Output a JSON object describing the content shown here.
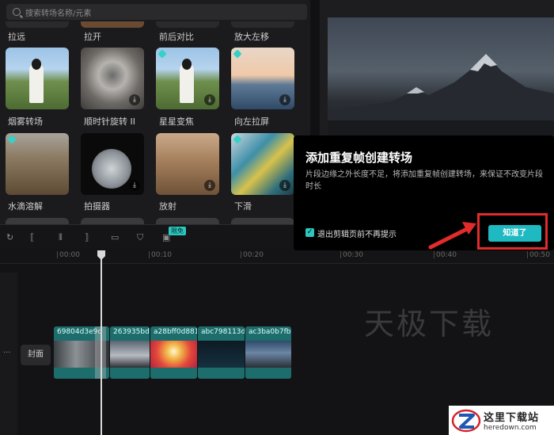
{
  "search": {
    "placeholder": "搜索转场名称/元素"
  },
  "transitions": {
    "row0": [
      "拉远",
      "拉开",
      "前后对比",
      "放大左移"
    ],
    "row1": [
      "烟雾转场",
      "顺时针旋转 II",
      "星星变焦",
      "向左拉屏"
    ],
    "row2": [
      "水滴溶解",
      "拍摄器",
      "放射",
      "下滑"
    ]
  },
  "toolbar": {
    "badge": "限免"
  },
  "ruler": {
    "ticks": [
      "00:00",
      "00:10",
      "00:20",
      "00:30",
      "00:40",
      "00:50"
    ]
  },
  "track": {
    "cover_label": "封面",
    "more": "···",
    "clips": [
      "69804d3e9c",
      "263935bd",
      "a28bff0d881",
      "abc798113d",
      "ac3ba0b7fb"
    ]
  },
  "watermark": "天极下载",
  "dialog": {
    "title": "添加重复帧创建转场",
    "body": "片段边缘之外长度不足，将添加重复帧创建转场，来保证不改变片段时长",
    "checkbox_label": "退出剪辑页前不再提示",
    "ok_label": "知道了"
  },
  "logo": {
    "cn": "这里下载站",
    "en": "heredown.com"
  },
  "colors": {
    "accent": "#1fb9c1",
    "highlight": "#e22b2b",
    "clip": "#1d6d6c"
  }
}
